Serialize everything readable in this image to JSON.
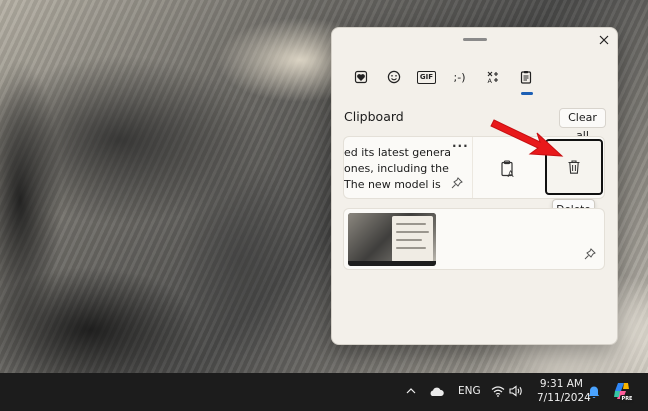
{
  "panel": {
    "tabs": [
      {
        "name": "Recently used",
        "icon": "heart-sticker-icon"
      },
      {
        "name": "Emoji",
        "icon": "emoji-icon"
      },
      {
        "name": "GIF",
        "icon": "gif-icon",
        "label": "GIF"
      },
      {
        "name": "Kaomoji",
        "icon": "kaomoji-icon",
        "label": ";-)"
      },
      {
        "name": "Symbols",
        "icon": "symbols-icon"
      },
      {
        "name": "Clipboard",
        "icon": "clipboard-icon",
        "active": true
      }
    ],
    "section_title": "Clipboard",
    "clear_all_label": "Clear all",
    "items": [
      {
        "type": "text",
        "lines": [
          "ed its latest genera",
          "ones, including the",
          "The new model is"
        ],
        "more_label": "···",
        "actions": [
          "paste-as-plain-text",
          "delete"
        ]
      },
      {
        "type": "image",
        "description": "screenshot thumbnail"
      }
    ],
    "tooltip": "Delete"
  },
  "taskbar": {
    "language": "ENG",
    "time": "9:31 AM",
    "date": "7/11/2024",
    "copilot_badge": "PRE"
  },
  "colors": {
    "accent": "#1c5fb5",
    "arrow": "#e8191b",
    "taskbar": "#1c1c1c",
    "panel": "#f3f0ea"
  }
}
